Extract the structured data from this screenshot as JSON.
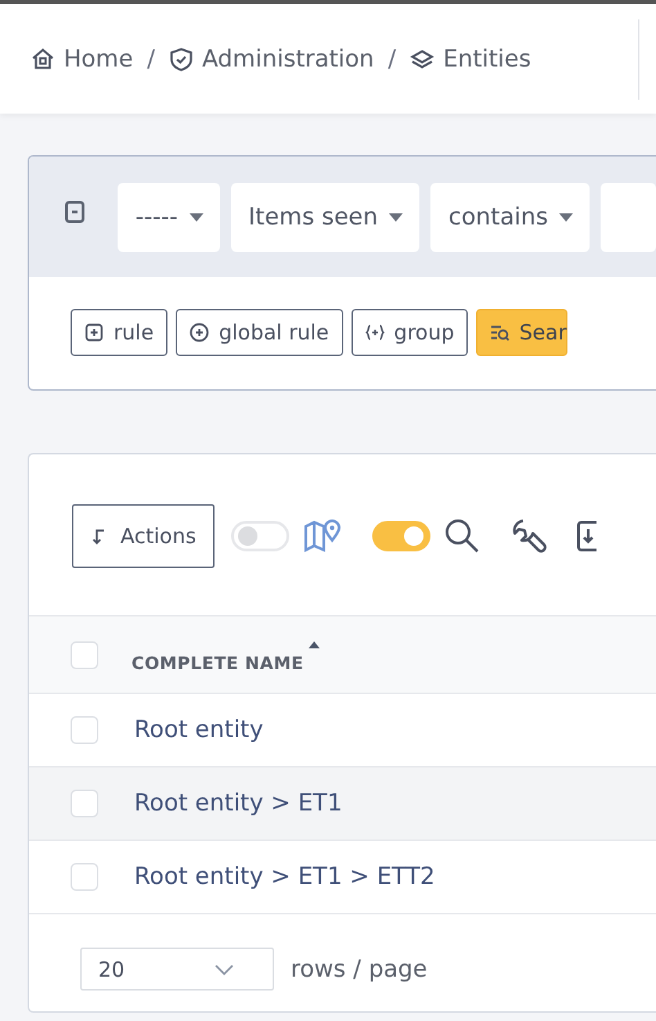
{
  "breadcrumb": [
    {
      "label": "Home",
      "separator": "/"
    },
    {
      "label": "Administration",
      "separator": "/"
    },
    {
      "label": "Entities"
    }
  ],
  "filter": {
    "criteria": [
      {
        "value": "-----"
      },
      {
        "value": "Items seen"
      },
      {
        "value": "contains"
      }
    ],
    "buttons": [
      {
        "label": "rule",
        "kind": "outline"
      },
      {
        "label": "global rule",
        "kind": "outline"
      },
      {
        "label": "group",
        "kind": "outline"
      },
      {
        "label": "Sear",
        "kind": "primary"
      }
    ]
  },
  "toolbar": {
    "actions_label": "Actions",
    "toggles": [
      {
        "on": false
      },
      {
        "on": true
      }
    ]
  },
  "table": {
    "columns": [
      {
        "label": "COMPLETE NAME",
        "sorted": true
      }
    ],
    "rows": [
      {
        "name": "Root entity",
        "checked": false,
        "hovered": false
      },
      {
        "name": "Root entity > ET1",
        "checked": false,
        "hovered": true
      },
      {
        "name": "Root entity > ET1 > ETT2",
        "checked": false,
        "hovered": false
      }
    ],
    "all_checked": false
  },
  "pagination": {
    "page_size": "20",
    "label": "rows / page"
  }
}
